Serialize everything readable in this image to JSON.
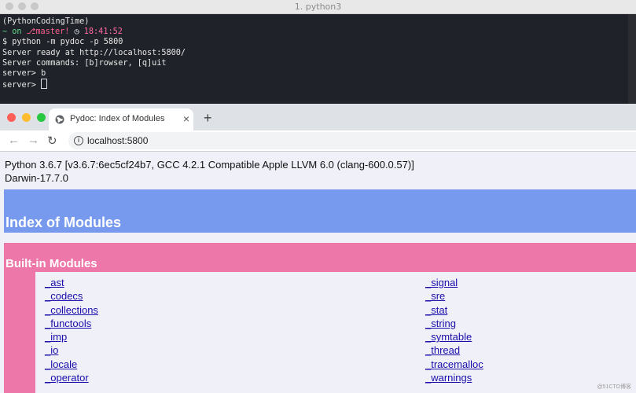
{
  "terminal": {
    "title": "1. python3",
    "lines": {
      "l1": "(PythonCodingTime)",
      "l2_prefix": "~ on ",
      "l2_branch": "master! ",
      "l2_time": "18:41:52",
      "l3": "$ python -m pydoc -p 5800",
      "l4": "Server ready at http://localhost:5800/",
      "l5": "Server commands: [b]rowser, [q]uit",
      "l6": "server> b",
      "l7": "server> "
    }
  },
  "browser": {
    "tab_title": "Pydoc: Index of Modules",
    "tab_close": "×",
    "new_tab": "+",
    "url": "localhost:5800"
  },
  "page": {
    "python_version": "Python 3.6.7 [v3.6.7:6ec5cf24b7, GCC 4.2.1 Compatible Apple LLVM 6.0 (clang-600.0.57)]",
    "platform": "Darwin-17.7.0",
    "index_heading": "Index of Modules",
    "builtin_heading": "Built-in Modules",
    "modules_left": [
      "_ast",
      "_codecs",
      "_collections",
      "_functools",
      "_imp",
      "_io",
      "_locale",
      "_operator"
    ],
    "modules_right": [
      "_signal",
      "_sre",
      "_stat",
      "_string",
      "_symtable",
      "_thread",
      "_tracemalloc",
      "_warnings"
    ]
  },
  "watermark": "@51CTO博客",
  "colors": {
    "heading_blue": "#7799ee",
    "section_pink": "#ee77aa",
    "page_bg": "#f0f0f8"
  }
}
